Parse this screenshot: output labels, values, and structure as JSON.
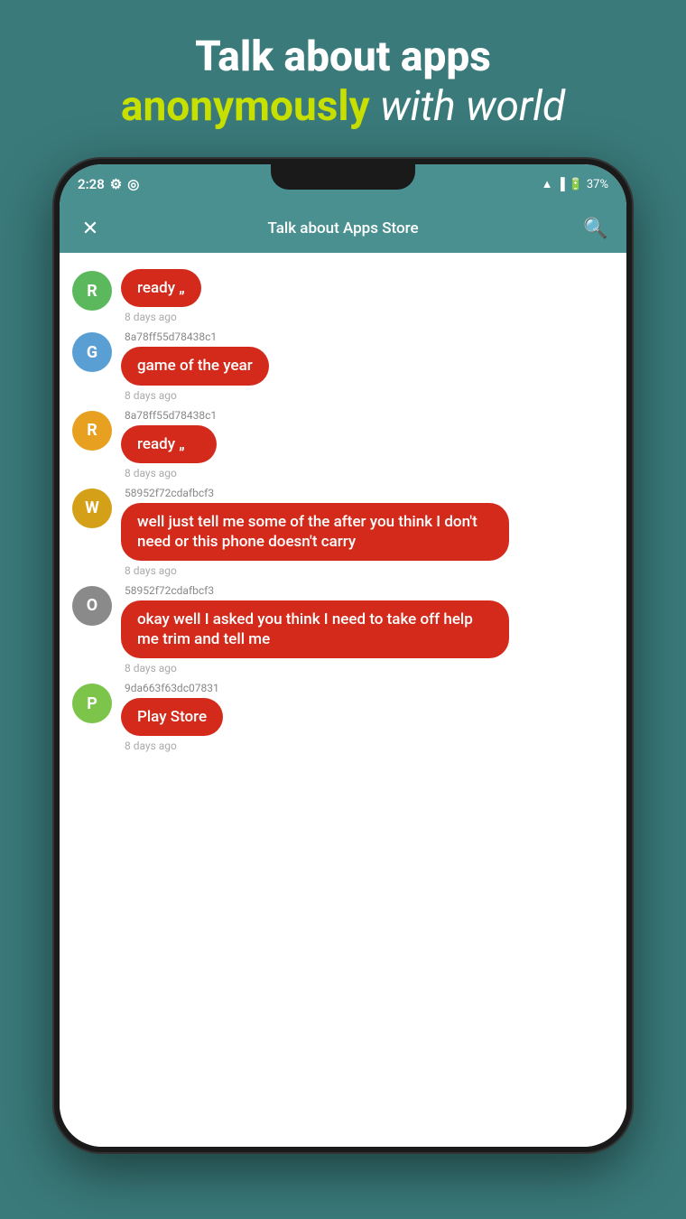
{
  "header": {
    "title": "Talk about apps",
    "subtitle_anon": "anonymously",
    "subtitle_world": "with world"
  },
  "status_bar": {
    "time": "2:28",
    "battery": "37%"
  },
  "app_bar": {
    "title": "Talk about Apps Store",
    "close_label": "×",
    "search_label": "🔍"
  },
  "messages": [
    {
      "avatar_letter": "R",
      "avatar_class": "avatar-green",
      "user_id": "",
      "bubble_text": "ready „",
      "timestamp": "8 days ago"
    },
    {
      "avatar_letter": "G",
      "avatar_class": "avatar-blue",
      "user_id": "8a78ff55d78438c1",
      "bubble_text": "game of the year",
      "timestamp": "8 days ago"
    },
    {
      "avatar_letter": "R",
      "avatar_class": "avatar-orange",
      "user_id": "8a78ff55d78438c1",
      "bubble_text": "ready „",
      "timestamp": "8 days ago"
    },
    {
      "avatar_letter": "W",
      "avatar_class": "avatar-yellow",
      "user_id": "58952f72cdafbcf3",
      "bubble_text": "well just tell me some of the after you think I don't need or this phone doesn't carry",
      "timestamp": "8 days ago"
    },
    {
      "avatar_letter": "O",
      "avatar_class": "avatar-gray",
      "user_id": "58952f72cdafbcf3",
      "bubble_text": "okay well I asked you think I need to take off help me trim and tell me",
      "timestamp": "8 days ago"
    },
    {
      "avatar_letter": "P",
      "avatar_class": "avatar-lightgreen",
      "user_id": "9da663f63dc07831",
      "bubble_text": "Play Store",
      "timestamp": "8 days ago"
    }
  ]
}
